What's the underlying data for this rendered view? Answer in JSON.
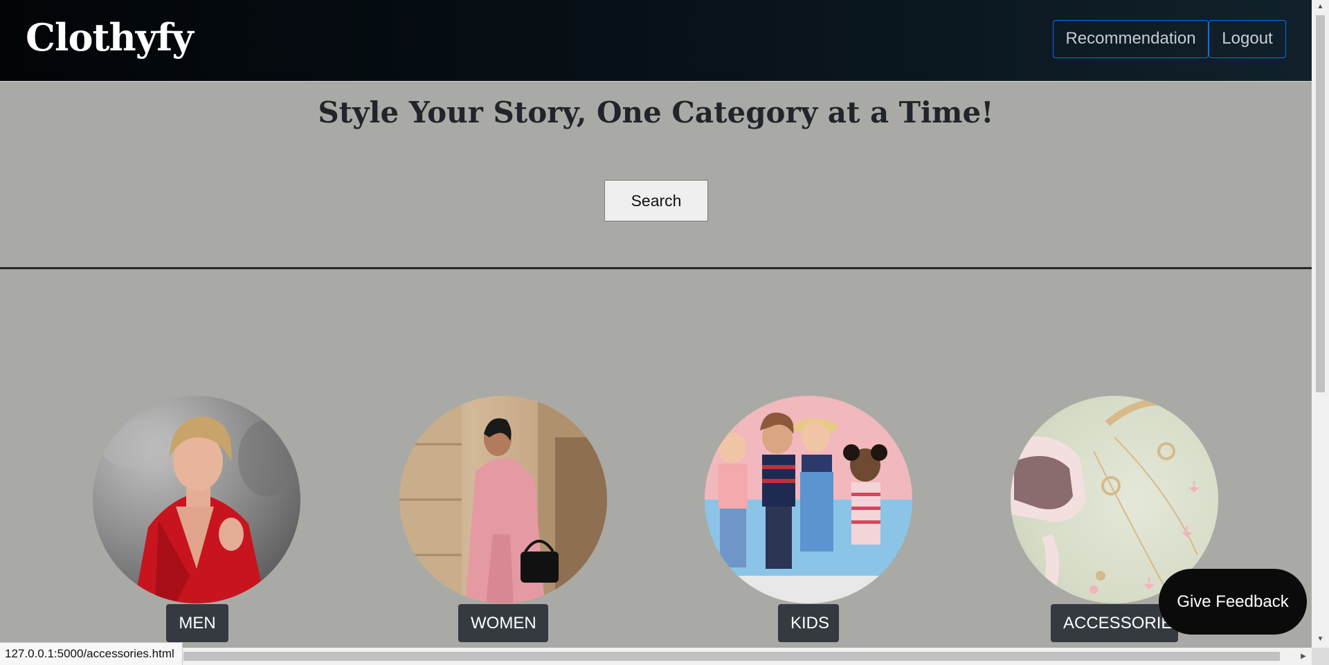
{
  "navbar": {
    "brand": "Clothyfy",
    "recommendation_label": "Recommendation",
    "logout_label": "Logout"
  },
  "hero": {
    "title": "Style Your Story, One Category at a Time!",
    "search_label": "Search"
  },
  "categories": [
    {
      "label": "MEN",
      "image": "men-category-image"
    },
    {
      "label": "WOMEN",
      "image": "women-category-image"
    },
    {
      "label": "KIDS",
      "image": "kids-category-image"
    },
    {
      "label": "ACCESSORIES",
      "image": "accessories-category-image"
    }
  ],
  "feedback": {
    "label": "Give Feedback"
  },
  "status_bar": {
    "url": "127.0.0.1:5000/accessories.html"
  },
  "colors": {
    "page_background": "#a9aaa5",
    "navbar_background": "#081219",
    "outline_button_border": "#0d6efd",
    "category_label_background": "#343a40",
    "feedback_background": "#0b0b0b"
  }
}
